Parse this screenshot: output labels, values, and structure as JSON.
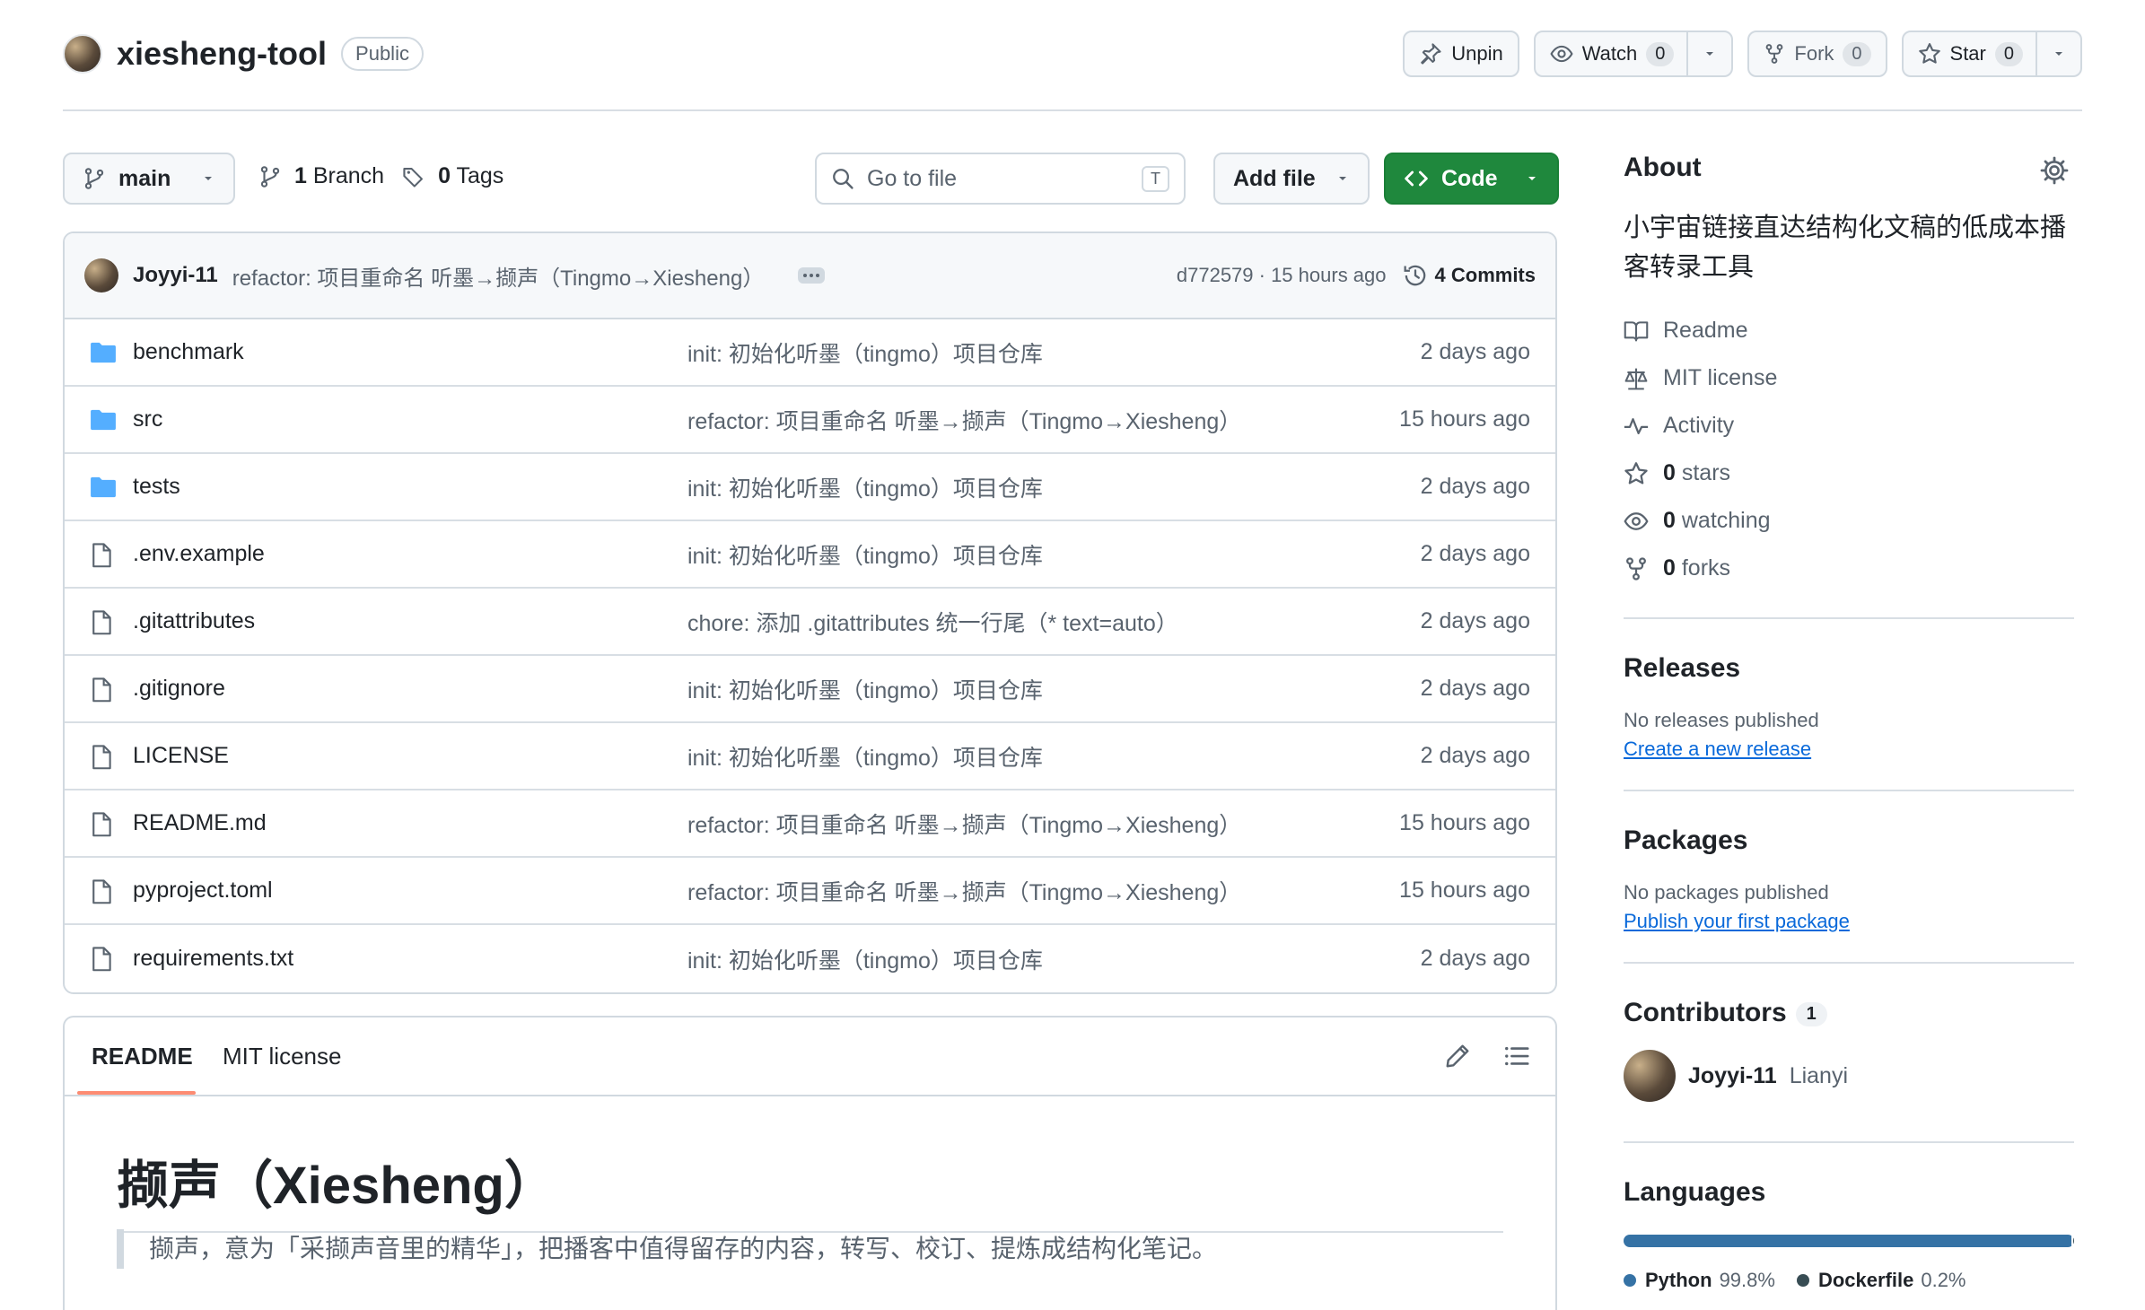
{
  "repo": {
    "name": "xiesheng-tool",
    "visibility": "Public",
    "actions": {
      "unpin": "Unpin",
      "watch": "Watch",
      "watch_count": "0",
      "fork": "Fork",
      "fork_count": "0",
      "star": "Star",
      "star_count": "0"
    }
  },
  "toolbar": {
    "branch": "main",
    "branch_count": "1",
    "branch_label": "Branch",
    "tag_count": "0",
    "tag_label": "Tags",
    "search_placeholder": "Go to file",
    "search_shortcut": "T",
    "add_file": "Add file",
    "code": "Code"
  },
  "last_commit": {
    "author": "Joyyi-11",
    "message": "refactor: 项目重命名 听墨→撷声（Tingmo→Xiesheng）",
    "sha_time": "d772579 · 15 hours ago",
    "commits_count": "4 Commits"
  },
  "files": [
    {
      "type": "dir",
      "name": "benchmark",
      "message": "init: 初始化听墨（tingmo）项目仓库",
      "date": "2 days ago"
    },
    {
      "type": "dir",
      "name": "src",
      "message": "refactor: 项目重命名 听墨→撷声（Tingmo→Xiesheng）",
      "date": "15 hours ago"
    },
    {
      "type": "dir",
      "name": "tests",
      "message": "init: 初始化听墨（tingmo）项目仓库",
      "date": "2 days ago"
    },
    {
      "type": "file",
      "name": ".env.example",
      "message": "init: 初始化听墨（tingmo）项目仓库",
      "date": "2 days ago"
    },
    {
      "type": "file",
      "name": ".gitattributes",
      "message": "chore: 添加 .gitattributes 统一行尾（* text=auto）",
      "date": "2 days ago"
    },
    {
      "type": "file",
      "name": ".gitignore",
      "message": "init: 初始化听墨（tingmo）项目仓库",
      "date": "2 days ago"
    },
    {
      "type": "file",
      "name": "LICENSE",
      "message": "init: 初始化听墨（tingmo）项目仓库",
      "date": "2 days ago"
    },
    {
      "type": "file",
      "name": "README.md",
      "message": "refactor: 项目重命名 听墨→撷声（Tingmo→Xiesheng）",
      "date": "15 hours ago"
    },
    {
      "type": "file",
      "name": "pyproject.toml",
      "message": "refactor: 项目重命名 听墨→撷声（Tingmo→Xiesheng）",
      "date": "15 hours ago"
    },
    {
      "type": "file",
      "name": "requirements.txt",
      "message": "init: 初始化听墨（tingmo）项目仓库",
      "date": "2 days ago"
    }
  ],
  "readme": {
    "tabs": [
      "README",
      "MIT license"
    ],
    "heading": "撷声（Xiesheng）",
    "quote": "撷声，意为「采撷声音里的精华」，把播客中值得留存的内容，转写、校订、提炼成结构化笔记。"
  },
  "about": {
    "title": "About",
    "description": "小宇宙链接直达结构化文稿的低成本播客转录工具",
    "items": [
      {
        "icon": "book-icon",
        "label": "Readme",
        "count": ""
      },
      {
        "icon": "scale-icon",
        "label": "MIT license",
        "count": ""
      },
      {
        "icon": "pulse-icon",
        "label": "Activity",
        "count": ""
      },
      {
        "icon": "star-icon",
        "label": "stars",
        "count": "0"
      },
      {
        "icon": "eye-icon",
        "label": "watching",
        "count": "0"
      },
      {
        "icon": "fork-icon",
        "label": "forks",
        "count": "0"
      }
    ]
  },
  "releases": {
    "title": "Releases",
    "status": "No releases published",
    "link": "Create a new release"
  },
  "packages": {
    "title": "Packages",
    "status": "No packages published",
    "link": "Publish your first package"
  },
  "contributors": {
    "title": "Contributors",
    "count": "1",
    "list": [
      {
        "login": "Joyyi-11",
        "name": "Lianyi"
      }
    ]
  },
  "languages": {
    "title": "Languages",
    "items": [
      {
        "name": "Python",
        "percent": "99.8%",
        "share": 99.8,
        "color": "#3572A5"
      },
      {
        "name": "Dockerfile",
        "percent": "0.2%",
        "share": 0.2,
        "color": "#384d54"
      }
    ]
  }
}
